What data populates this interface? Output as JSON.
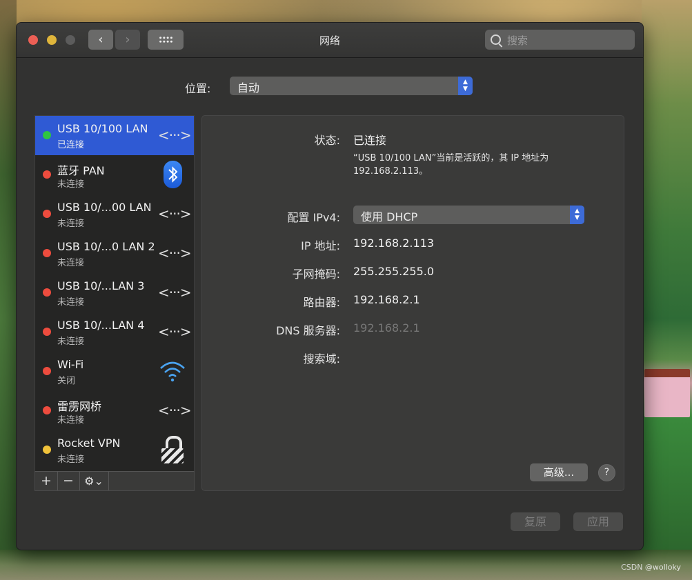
{
  "window": {
    "title": "网络"
  },
  "search": {
    "placeholder": "搜索"
  },
  "location": {
    "label": "位置:",
    "value": "自动"
  },
  "services": [
    {
      "name": "USB 10/100 LAN",
      "status": "已连接",
      "dot": "#2fc542",
      "icon": "ethernet-icon",
      "selected": true
    },
    {
      "name": "蓝牙 PAN",
      "status": "未连接",
      "dot": "#ed4c3e",
      "icon": "bluetooth-icon"
    },
    {
      "name": "USB 10/...00 LAN",
      "status": "未连接",
      "dot": "#ed4c3e",
      "icon": "ethernet-icon"
    },
    {
      "name": "USB 10/...0 LAN 2",
      "status": "未连接",
      "dot": "#ed4c3e",
      "icon": "ethernet-icon"
    },
    {
      "name": "USB 10/...LAN 3",
      "status": "未连接",
      "dot": "#ed4c3e",
      "icon": "ethernet-icon"
    },
    {
      "name": "USB 10/...LAN 4",
      "status": "未连接",
      "dot": "#ed4c3e",
      "icon": "ethernet-icon"
    },
    {
      "name": "Wi-Fi",
      "status": "关闭",
      "dot": "#ed4c3e",
      "icon": "wifi-icon"
    },
    {
      "name": "雷雳网桥",
      "status": "未连接",
      "dot": "#ed4c3e",
      "icon": "ethernet-icon"
    },
    {
      "name": "Rocket VPN",
      "status": "未连接",
      "dot": "#f0c23a",
      "icon": "lock-icon"
    }
  ],
  "list_toolbar": {
    "add": "+",
    "remove": "−",
    "gear": "⚙⌄"
  },
  "detail": {
    "status_label": "状态:",
    "status_value": "已连接",
    "description": "“USB 10/100 LAN”当前是活跃的，其 IP 地址为 192.168.2.113。",
    "config_label": "配置 IPv4:",
    "config_value": "使用 DHCP",
    "ip_label": "IP 地址:",
    "ip_value": "192.168.2.113",
    "subnet_label": "子网掩码:",
    "subnet_value": "255.255.255.0",
    "router_label": "路由器:",
    "router_value": "192.168.2.1",
    "dns_label": "DNS 服务器:",
    "dns_value": "192.168.2.1",
    "domain_label": "搜索域:",
    "domain_value": "",
    "advanced_button": "高级...",
    "help_button": "?"
  },
  "footer": {
    "revert": "复原",
    "apply": "应用"
  },
  "watermark": "CSDN @wolloky"
}
